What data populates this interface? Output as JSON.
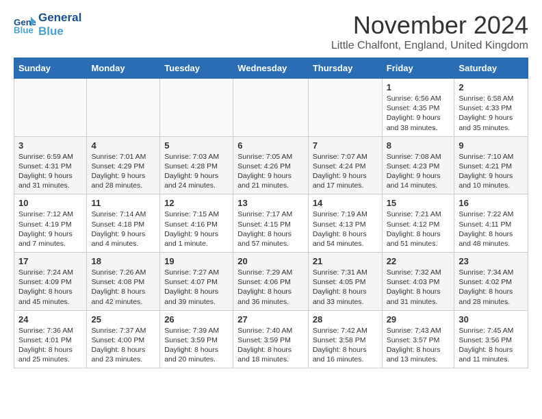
{
  "header": {
    "logo_line1": "General",
    "logo_line2": "Blue",
    "month_title": "November 2024",
    "location": "Little Chalfont, England, United Kingdom"
  },
  "weekdays": [
    "Sunday",
    "Monday",
    "Tuesday",
    "Wednesday",
    "Thursday",
    "Friday",
    "Saturday"
  ],
  "weeks": [
    [
      {
        "day": "",
        "info": ""
      },
      {
        "day": "",
        "info": ""
      },
      {
        "day": "",
        "info": ""
      },
      {
        "day": "",
        "info": ""
      },
      {
        "day": "",
        "info": ""
      },
      {
        "day": "1",
        "info": "Sunrise: 6:56 AM\nSunset: 4:35 PM\nDaylight: 9 hours and 38 minutes."
      },
      {
        "day": "2",
        "info": "Sunrise: 6:58 AM\nSunset: 4:33 PM\nDaylight: 9 hours and 35 minutes."
      }
    ],
    [
      {
        "day": "3",
        "info": "Sunrise: 6:59 AM\nSunset: 4:31 PM\nDaylight: 9 hours and 31 minutes."
      },
      {
        "day": "4",
        "info": "Sunrise: 7:01 AM\nSunset: 4:29 PM\nDaylight: 9 hours and 28 minutes."
      },
      {
        "day": "5",
        "info": "Sunrise: 7:03 AM\nSunset: 4:28 PM\nDaylight: 9 hours and 24 minutes."
      },
      {
        "day": "6",
        "info": "Sunrise: 7:05 AM\nSunset: 4:26 PM\nDaylight: 9 hours and 21 minutes."
      },
      {
        "day": "7",
        "info": "Sunrise: 7:07 AM\nSunset: 4:24 PM\nDaylight: 9 hours and 17 minutes."
      },
      {
        "day": "8",
        "info": "Sunrise: 7:08 AM\nSunset: 4:23 PM\nDaylight: 9 hours and 14 minutes."
      },
      {
        "day": "9",
        "info": "Sunrise: 7:10 AM\nSunset: 4:21 PM\nDaylight: 9 hours and 10 minutes."
      }
    ],
    [
      {
        "day": "10",
        "info": "Sunrise: 7:12 AM\nSunset: 4:19 PM\nDaylight: 9 hours and 7 minutes."
      },
      {
        "day": "11",
        "info": "Sunrise: 7:14 AM\nSunset: 4:18 PM\nDaylight: 9 hours and 4 minutes."
      },
      {
        "day": "12",
        "info": "Sunrise: 7:15 AM\nSunset: 4:16 PM\nDaylight: 9 hours and 1 minute."
      },
      {
        "day": "13",
        "info": "Sunrise: 7:17 AM\nSunset: 4:15 PM\nDaylight: 8 hours and 57 minutes."
      },
      {
        "day": "14",
        "info": "Sunrise: 7:19 AM\nSunset: 4:13 PM\nDaylight: 8 hours and 54 minutes."
      },
      {
        "day": "15",
        "info": "Sunrise: 7:21 AM\nSunset: 4:12 PM\nDaylight: 8 hours and 51 minutes."
      },
      {
        "day": "16",
        "info": "Sunrise: 7:22 AM\nSunset: 4:11 PM\nDaylight: 8 hours and 48 minutes."
      }
    ],
    [
      {
        "day": "17",
        "info": "Sunrise: 7:24 AM\nSunset: 4:09 PM\nDaylight: 8 hours and 45 minutes."
      },
      {
        "day": "18",
        "info": "Sunrise: 7:26 AM\nSunset: 4:08 PM\nDaylight: 8 hours and 42 minutes."
      },
      {
        "day": "19",
        "info": "Sunrise: 7:27 AM\nSunset: 4:07 PM\nDaylight: 8 hours and 39 minutes."
      },
      {
        "day": "20",
        "info": "Sunrise: 7:29 AM\nSunset: 4:06 PM\nDaylight: 8 hours and 36 minutes."
      },
      {
        "day": "21",
        "info": "Sunrise: 7:31 AM\nSunset: 4:05 PM\nDaylight: 8 hours and 33 minutes."
      },
      {
        "day": "22",
        "info": "Sunrise: 7:32 AM\nSunset: 4:03 PM\nDaylight: 8 hours and 31 minutes."
      },
      {
        "day": "23",
        "info": "Sunrise: 7:34 AM\nSunset: 4:02 PM\nDaylight: 8 hours and 28 minutes."
      }
    ],
    [
      {
        "day": "24",
        "info": "Sunrise: 7:36 AM\nSunset: 4:01 PM\nDaylight: 8 hours and 25 minutes."
      },
      {
        "day": "25",
        "info": "Sunrise: 7:37 AM\nSunset: 4:00 PM\nDaylight: 8 hours and 23 minutes."
      },
      {
        "day": "26",
        "info": "Sunrise: 7:39 AM\nSunset: 3:59 PM\nDaylight: 8 hours and 20 minutes."
      },
      {
        "day": "27",
        "info": "Sunrise: 7:40 AM\nSunset: 3:59 PM\nDaylight: 8 hours and 18 minutes."
      },
      {
        "day": "28",
        "info": "Sunrise: 7:42 AM\nSunset: 3:58 PM\nDaylight: 8 hours and 16 minutes."
      },
      {
        "day": "29",
        "info": "Sunrise: 7:43 AM\nSunset: 3:57 PM\nDaylight: 8 hours and 13 minutes."
      },
      {
        "day": "30",
        "info": "Sunrise: 7:45 AM\nSunset: 3:56 PM\nDaylight: 8 hours and 11 minutes."
      }
    ]
  ]
}
